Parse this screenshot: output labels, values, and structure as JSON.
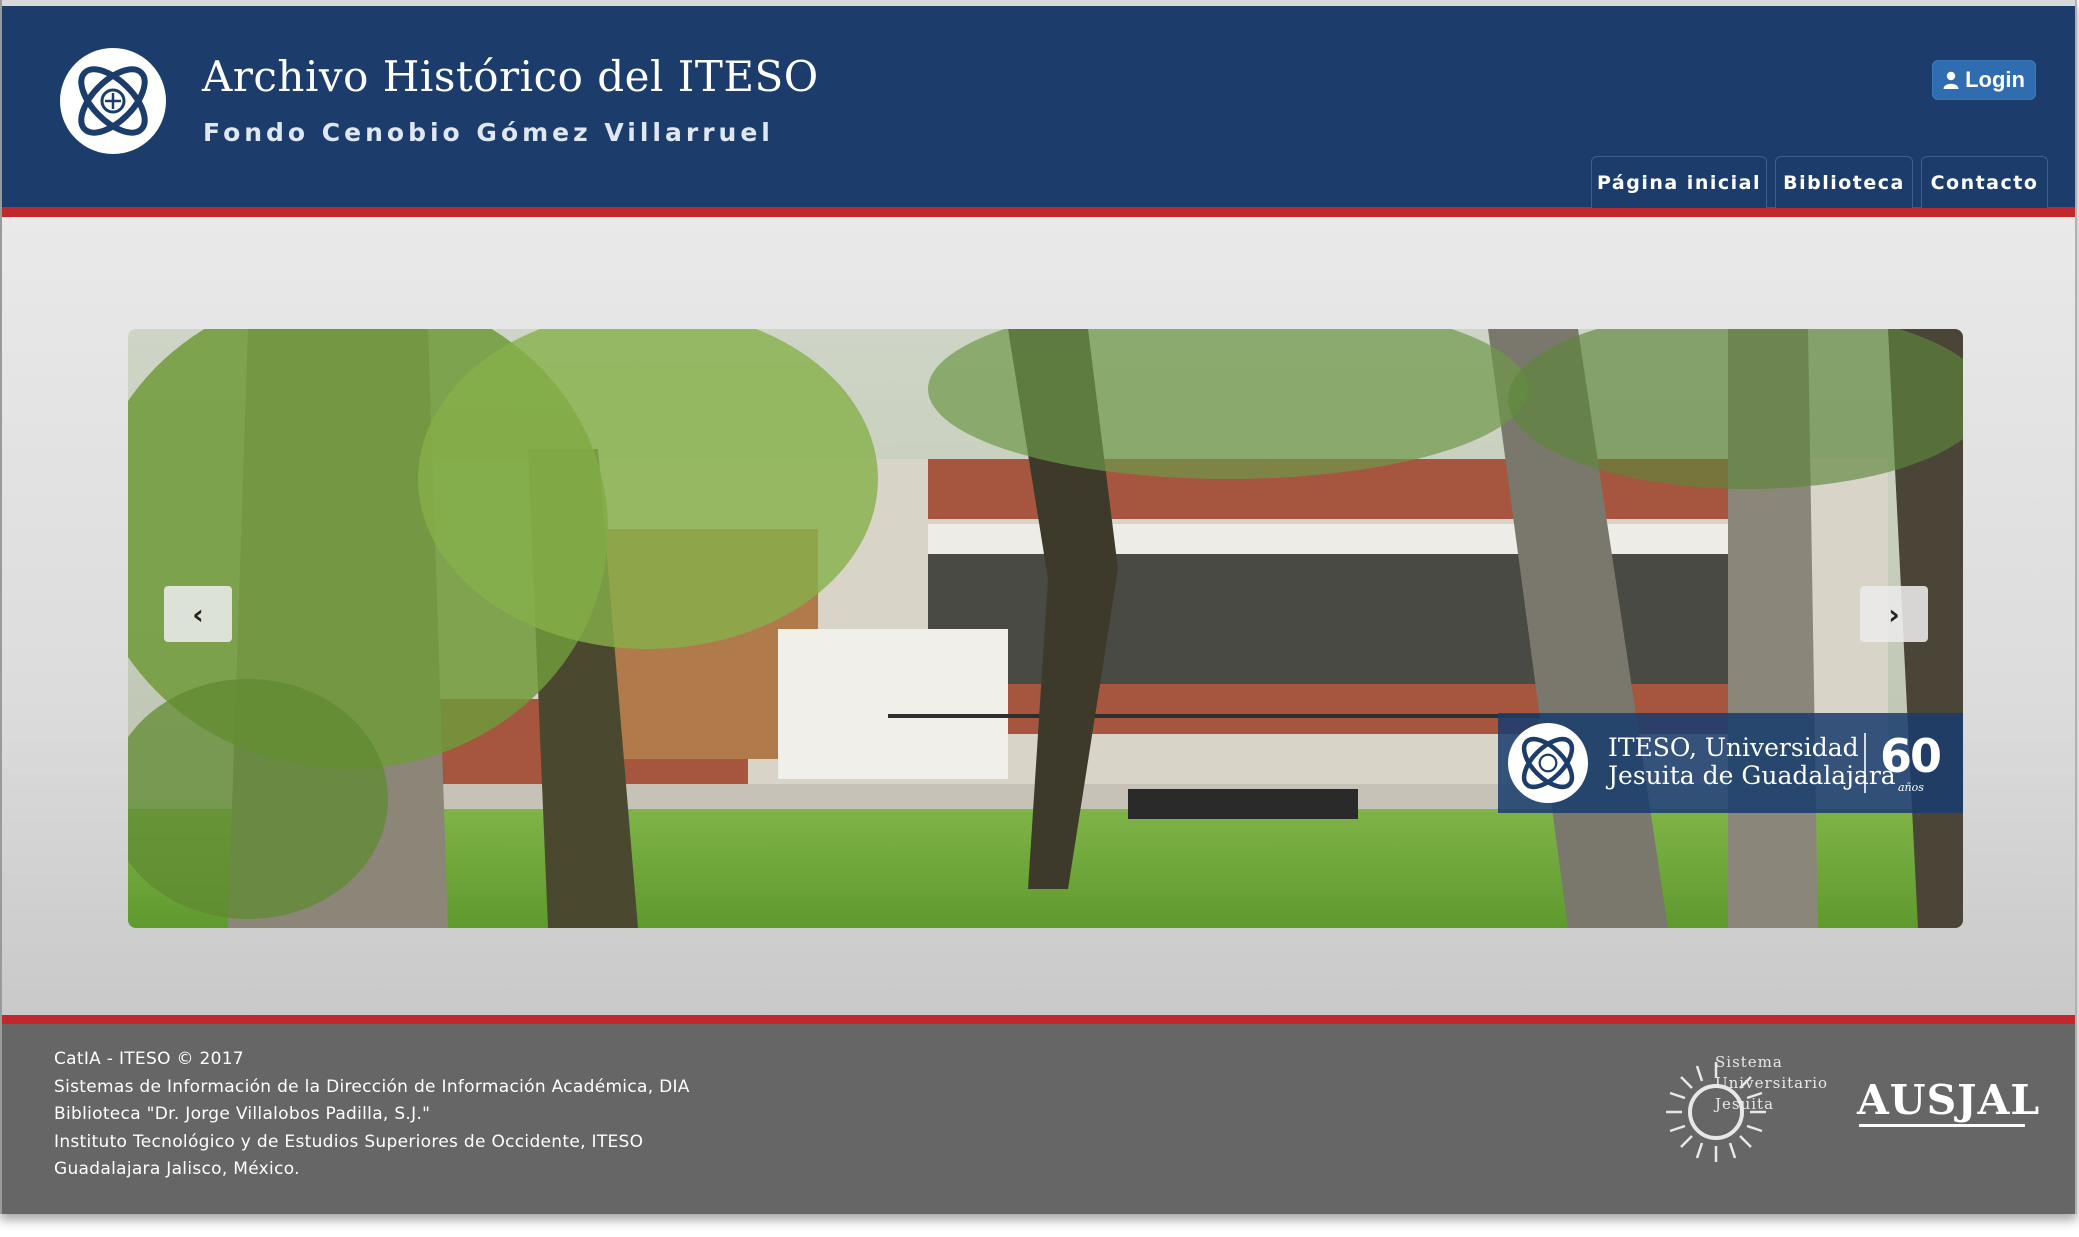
{
  "header": {
    "title": "Archivo Histórico del ITESO",
    "subtitle": "Fondo Cenobio Gómez Villarruel",
    "login_label": "Login",
    "colors": {
      "background": "#1c3d6b",
      "accent_stripe": "#c1272d",
      "login_button": "#2f6db0"
    }
  },
  "nav": {
    "items": [
      {
        "label": "Página inicial"
      },
      {
        "label": "Biblioteca"
      },
      {
        "label": "Contacto"
      }
    ]
  },
  "carousel": {
    "prev_icon": "chevron-left-icon",
    "next_icon": "chevron-right-icon",
    "prev_glyph": "‹",
    "next_glyph": "›",
    "badge": {
      "line1": "ITESO, Universidad",
      "line2": "Jesuita de Guadalajara",
      "years": "60",
      "years_label": "años"
    }
  },
  "footer": {
    "lines": [
      "CatIA - ITESO © 2017",
      "Sistemas de Información de la Dirección de Información Académica, DIA",
      "Biblioteca \"Dr. Jorge Villalobos Padilla, S.J.\"",
      "Instituto Tecnológico y de Estudios Superiores de Occidente, ITESO",
      "Guadalajara Jalisco, México."
    ],
    "suj_logo": {
      "line1": "Sistema",
      "line2": "Universitario",
      "line3": "Jesuita"
    },
    "ausjal_logo": "AUSJAL",
    "colors": {
      "background": "#666666"
    }
  }
}
